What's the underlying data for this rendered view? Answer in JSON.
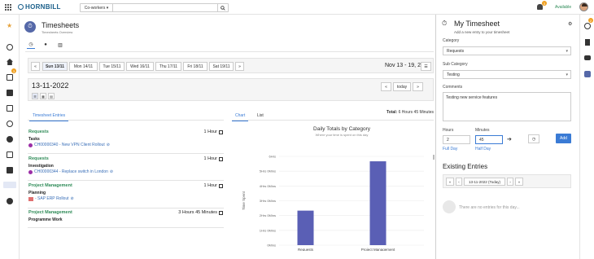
{
  "topbar": {
    "logo": "HORNBILL",
    "search_scope": "Co-workers",
    "search_placeholder": "",
    "notif_count": "3",
    "status": "Available"
  },
  "leftbar": {
    "badge": "3"
  },
  "rightbar": {
    "badge": "2"
  },
  "page": {
    "title": "Timesheets",
    "subtitle": "Timesheets Overview"
  },
  "week": {
    "days": [
      "Sun 13/11",
      "Mon 14/11",
      "Tue 15/11",
      "Wed 16/11",
      "Thu 17/11",
      "Fri 18/11",
      "Sat 19/11"
    ],
    "range": "Nov 13 - 19, 2022"
  },
  "date": {
    "current": "13-11-2022",
    "today_label": "today"
  },
  "entries_tab": "Timesheet Entries",
  "entries": [
    {
      "category": "Requests",
      "subcategory": "Tasks",
      "item": "CH00000340 - New VPN Client Rollout",
      "hours": "1 Hour"
    },
    {
      "category": "Requests",
      "subcategory": "Investigation",
      "item": "CH00000344 - Replace switch in London",
      "hours": "1 Hour"
    },
    {
      "category": "Project Management",
      "subcategory": "Planning",
      "item": "- SAP ERP Rollout",
      "hours": "1 Hour"
    },
    {
      "category": "Project Management",
      "subcategory": "Programme Work",
      "item": "",
      "hours": "3 Hours 45 Minutes"
    }
  ],
  "chart_tabs": {
    "chart": "Chart",
    "list": "List"
  },
  "total": {
    "label": "Total:",
    "value": "6 Hours 45 Minutes"
  },
  "chart_data": {
    "type": "bar",
    "title": "Daily Totals by Category",
    "subtitle": "Where your time is spent on this day",
    "xlabel": "Categories",
    "ylabel": "Time Spent",
    "categories": [
      "Requests",
      "Project Management"
    ],
    "values": [
      140,
      340
    ],
    "ylim": [
      0,
      360
    ],
    "yticks": [
      "0Mins",
      "1Hrs 0Mins",
      "2Hrs 0Mins",
      "3Hrs 0Mins",
      "4Hrs 0Mins",
      "5Hrs 0Mins",
      "6Hrs"
    ],
    "color": "#5a5fb5"
  },
  "modal": {
    "title": "My Timesheet",
    "subtitle": "Add a new entry to your timesheet",
    "category_label": "Category",
    "category_value": "Requests",
    "subcategory_label": "Sub Category",
    "subcategory_value": "Testing",
    "comments_label": "Comments",
    "comments_value": "Testing new service features",
    "hours_label": "Hours",
    "hours_value": "2",
    "minutes_label": "Minutes",
    "minutes_value": "45",
    "full_day": "Full Day",
    "half_day": "Half Day",
    "add_label": "Add",
    "existing_title": "Existing Entries",
    "existing_date": "13-11-2022 (Today)",
    "no_entries": "There are no entries for this day..."
  }
}
